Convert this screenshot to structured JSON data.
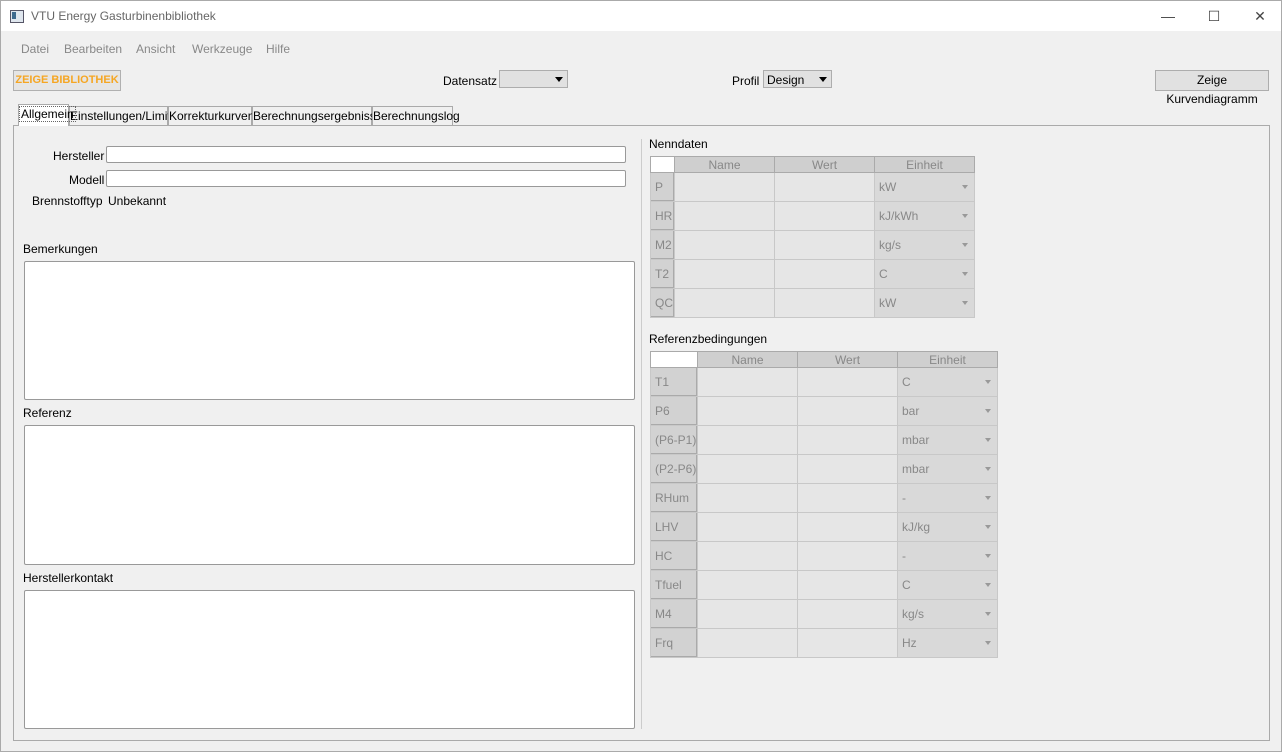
{
  "window": {
    "title": "VTU Energy Gasturbinenbibliothek",
    "minimize": "—",
    "maximize": "☐",
    "close": "✕"
  },
  "menu": [
    "Datei",
    "Bearbeiten",
    "Ansicht",
    "Werkzeuge",
    "Hilfe"
  ],
  "toolbar": {
    "library_button": "ZEIGE BIBLIOTHEK",
    "dataset_label": "Datensatz",
    "dataset_value": "",
    "profile_label": "Profil",
    "profile_value": "Design",
    "curve_button": "Zeige Kurvendiagramm"
  },
  "tabs": [
    "Allgemein",
    "Einstellungen/Limits",
    "Korrekturkurven",
    "Berechnungsergebnisse",
    "Berechnungslog"
  ],
  "general": {
    "manufacturer_label": "Hersteller",
    "manufacturer_value": "",
    "model_label": "Modell",
    "model_value": "",
    "fuel_label": "Brennstofftyp",
    "fuel_value": "Unbekannt",
    "remarks_label": "Bemerkungen",
    "reference_label": "Referenz",
    "contact_label": "Herstellerkontakt"
  },
  "rated": {
    "title": "Nenndaten",
    "headers": [
      "Name",
      "Wert",
      "Einheit"
    ],
    "rows": [
      {
        "key": "P",
        "unit": "kW"
      },
      {
        "key": "HR",
        "unit": "kJ/kWh"
      },
      {
        "key": "M2",
        "unit": "kg/s"
      },
      {
        "key": "T2",
        "unit": "C"
      },
      {
        "key": "QC",
        "unit": "kW"
      }
    ]
  },
  "reference_conditions": {
    "title": "Referenzbedingungen",
    "headers": [
      "Name",
      "Wert",
      "Einheit"
    ],
    "rows": [
      {
        "key": "T1",
        "unit": "C"
      },
      {
        "key": "P6",
        "unit": "bar"
      },
      {
        "key": "(P6-P1)",
        "unit": "mbar"
      },
      {
        "key": "(P2-P6)",
        "unit": "mbar"
      },
      {
        "key": "RHum",
        "unit": "-"
      },
      {
        "key": "LHV",
        "unit": "kJ/kg"
      },
      {
        "key": "HC",
        "unit": "-"
      },
      {
        "key": "Tfuel",
        "unit": "C"
      },
      {
        "key": "M4",
        "unit": "kg/s"
      },
      {
        "key": "Frq",
        "unit": "Hz"
      }
    ]
  }
}
